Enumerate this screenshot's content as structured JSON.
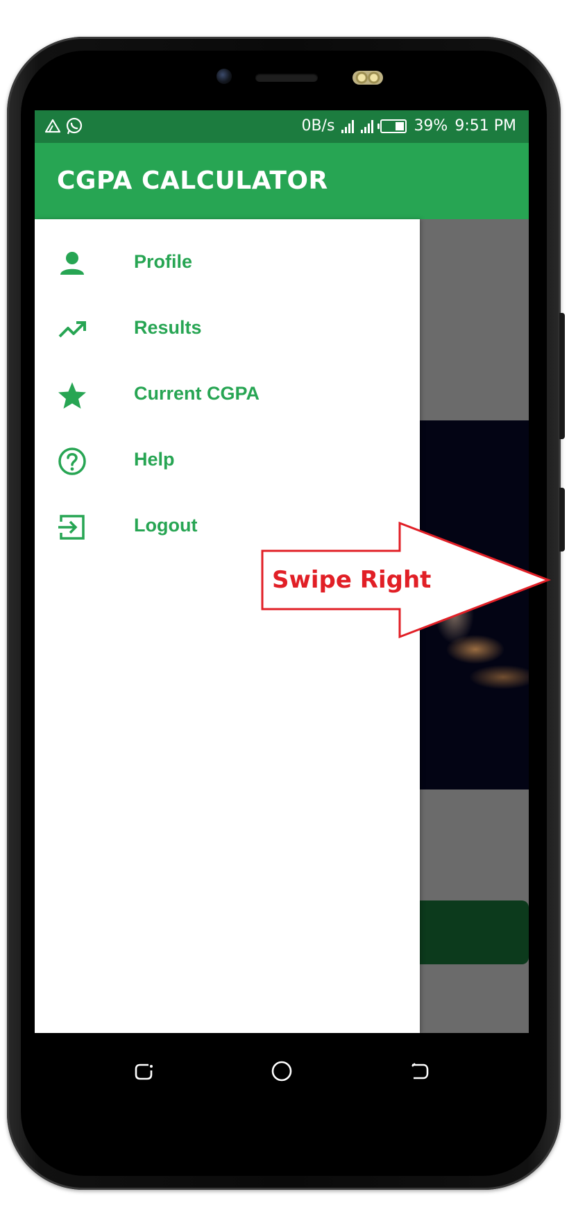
{
  "status_bar": {
    "speed": "0B/s",
    "battery_percent": "39%",
    "time": "9:51 PM",
    "icons": [
      "drive-icon",
      "whatsapp-icon",
      "signal-icon",
      "signal-hplus-icon",
      "battery-icon"
    ]
  },
  "app_bar": {
    "title": "CGPA CALCULATOR"
  },
  "drawer": {
    "items": [
      {
        "label": "Profile",
        "icon": "person-icon"
      },
      {
        "label": "Results",
        "icon": "trending-up-icon"
      },
      {
        "label": "Current CGPA",
        "icon": "star-icon"
      },
      {
        "label": "Help",
        "icon": "help-circle-icon"
      },
      {
        "label": "Logout",
        "icon": "exit-icon"
      }
    ]
  },
  "annotation": {
    "text": "Swipe Right"
  },
  "colors": {
    "primary": "#27a553",
    "primary_dark": "#1c7c3f",
    "annotation": "#e11f26"
  },
  "nav_bar": {
    "buttons": [
      "recent-apps-icon",
      "home-icon",
      "back-icon"
    ]
  }
}
